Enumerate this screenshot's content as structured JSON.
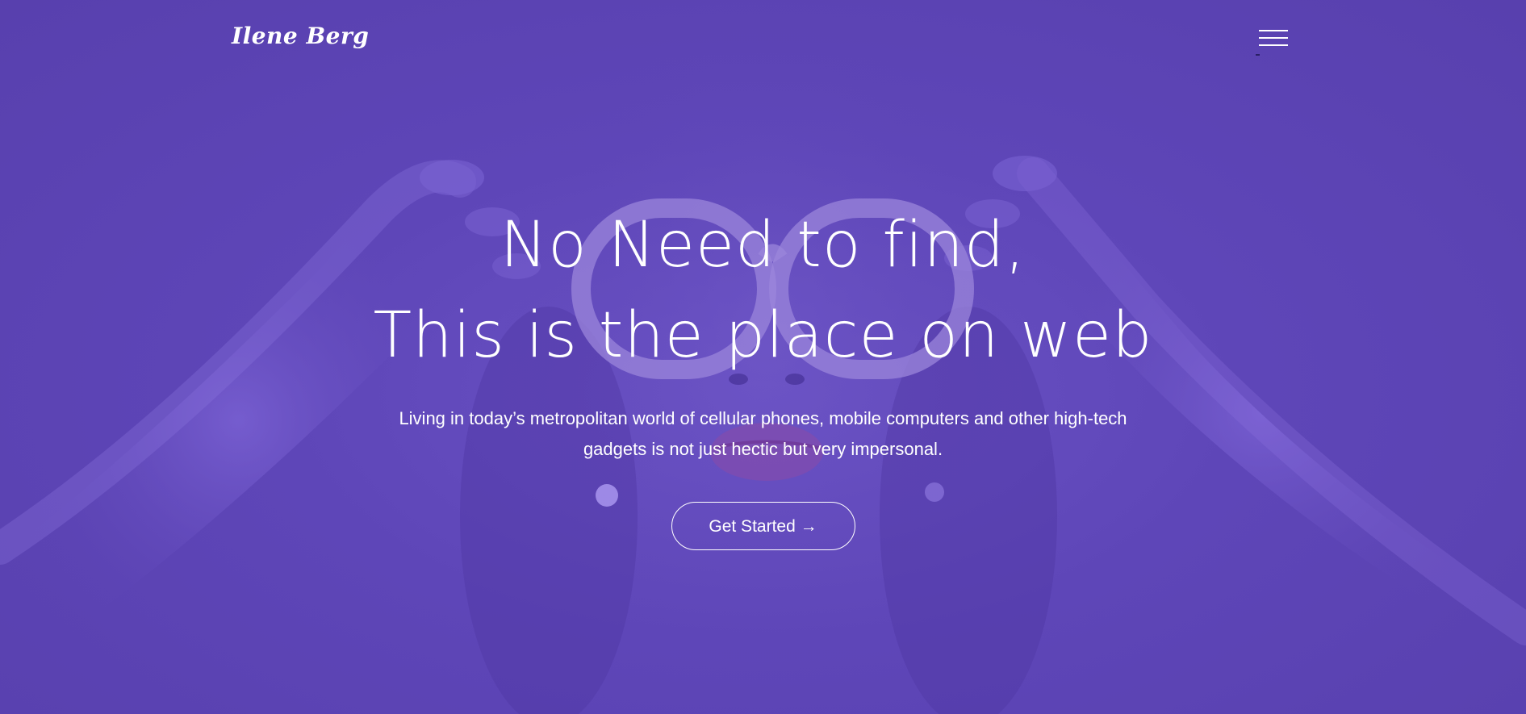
{
  "header": {
    "logo": "Ilene Berg",
    "menu_icon": "hamburger-menu-icon"
  },
  "hero": {
    "headline_line1": "No Need to find,",
    "headline_line2": "This is the place on web",
    "subtext": "Living in today’s metropolitan world of cellular phones, mobile computers and other high-tech gadgets is not just hectic but very impersonal.",
    "cta_label": "Get Started →",
    "background_image": "woman-with-glasses-photo"
  },
  "colors": {
    "overlay": "#5c44b4",
    "text": "#ffffff"
  }
}
